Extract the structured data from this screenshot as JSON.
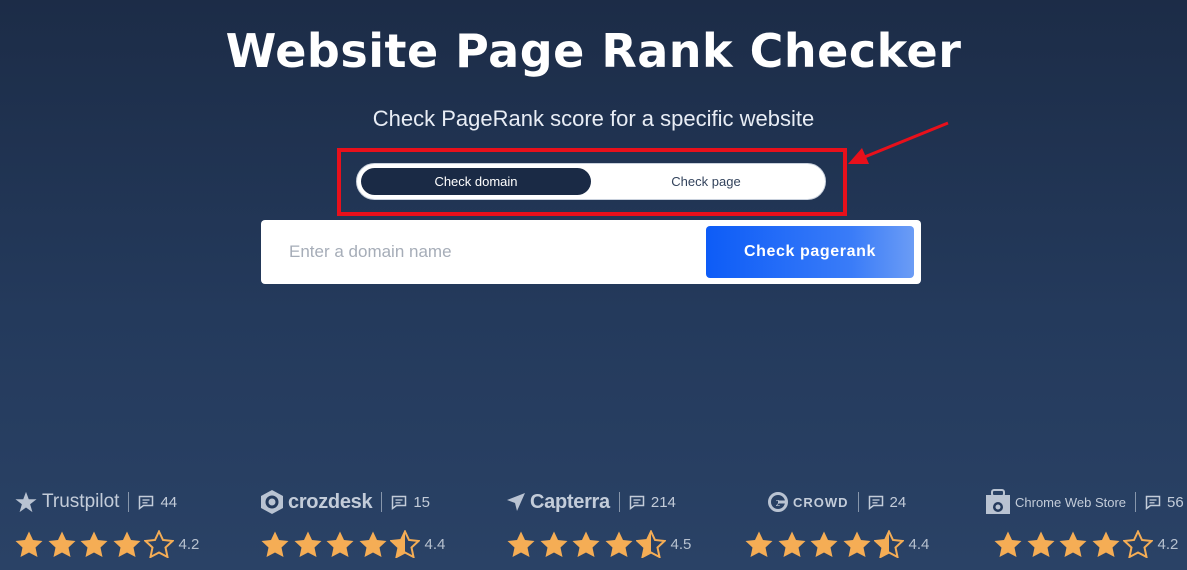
{
  "page": {
    "title": "Website Page Rank Checker",
    "subtitle": "Check PageRank score for a specific website"
  },
  "mode_toggle": {
    "options": [
      "Check domain",
      "Check page"
    ],
    "selected": "Check domain"
  },
  "search": {
    "placeholder": "Enter a domain name",
    "value": "",
    "button_label": "Check pagerank"
  },
  "colors": {
    "accent_blue": "#0d5cf7",
    "star_gold": "#f5ad55",
    "annotation_red": "#e8101b",
    "background": "#1c2c47"
  },
  "ratings": [
    {
      "brand": "Trustpilot",
      "icon": "star-icon",
      "reviews": "44",
      "score": "4.2",
      "stars": 4.2
    },
    {
      "brand": "crozdesk",
      "icon": "crozdesk-logo-icon",
      "reviews": "15",
      "score": "4.4",
      "stars": 4.4
    },
    {
      "brand": "Capterra",
      "icon": "capterra-arrow-icon",
      "reviews": "214",
      "score": "4.5",
      "stars": 4.5
    },
    {
      "brand": "CROWD",
      "icon": "g2-logo-icon",
      "reviews": "24",
      "score": "4.4",
      "stars": 4.4
    },
    {
      "brand": "Chrome Web Store",
      "icon": "chrome-web-store-icon",
      "reviews": "56",
      "score": "4.2",
      "stars": 4.2
    }
  ]
}
